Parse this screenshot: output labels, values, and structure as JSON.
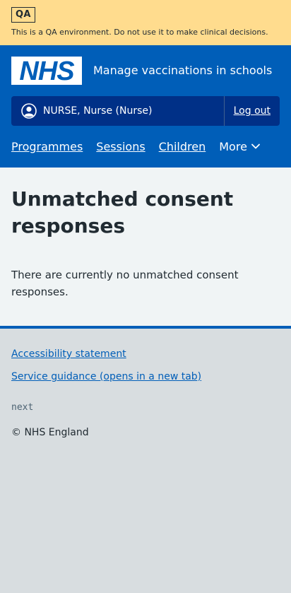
{
  "qa_banner": {
    "tag": "QA",
    "message": "This is a QA environment. Do not use it to make clinical decisions."
  },
  "header": {
    "logo_text": "NHS",
    "service_name": "Manage vaccinations in schools",
    "account": {
      "user_icon": "user-circle-icon",
      "user_name": "NURSE, Nurse (Nurse)",
      "logout_label": "Log out"
    },
    "nav": {
      "items": [
        {
          "label": "Programmes"
        },
        {
          "label": "Sessions"
        },
        {
          "label": "Children"
        }
      ],
      "more_label": "More",
      "more_icon": "chevron-down-icon"
    }
  },
  "main": {
    "title": "Unmatched consent responses",
    "message": "There are currently no unmatched consent responses."
  },
  "footer": {
    "links": [
      {
        "label": "Accessibility statement"
      },
      {
        "label": "Service guidance (opens in a new tab)"
      }
    ],
    "version": "next",
    "copyright": "© NHS England"
  },
  "colors": {
    "qa_banner_bg": "#ffdc8e",
    "nhs_blue": "#005eb8",
    "account_bg": "#003087",
    "main_bg": "#f0f4f5",
    "footer_bg": "#d8dde0"
  }
}
